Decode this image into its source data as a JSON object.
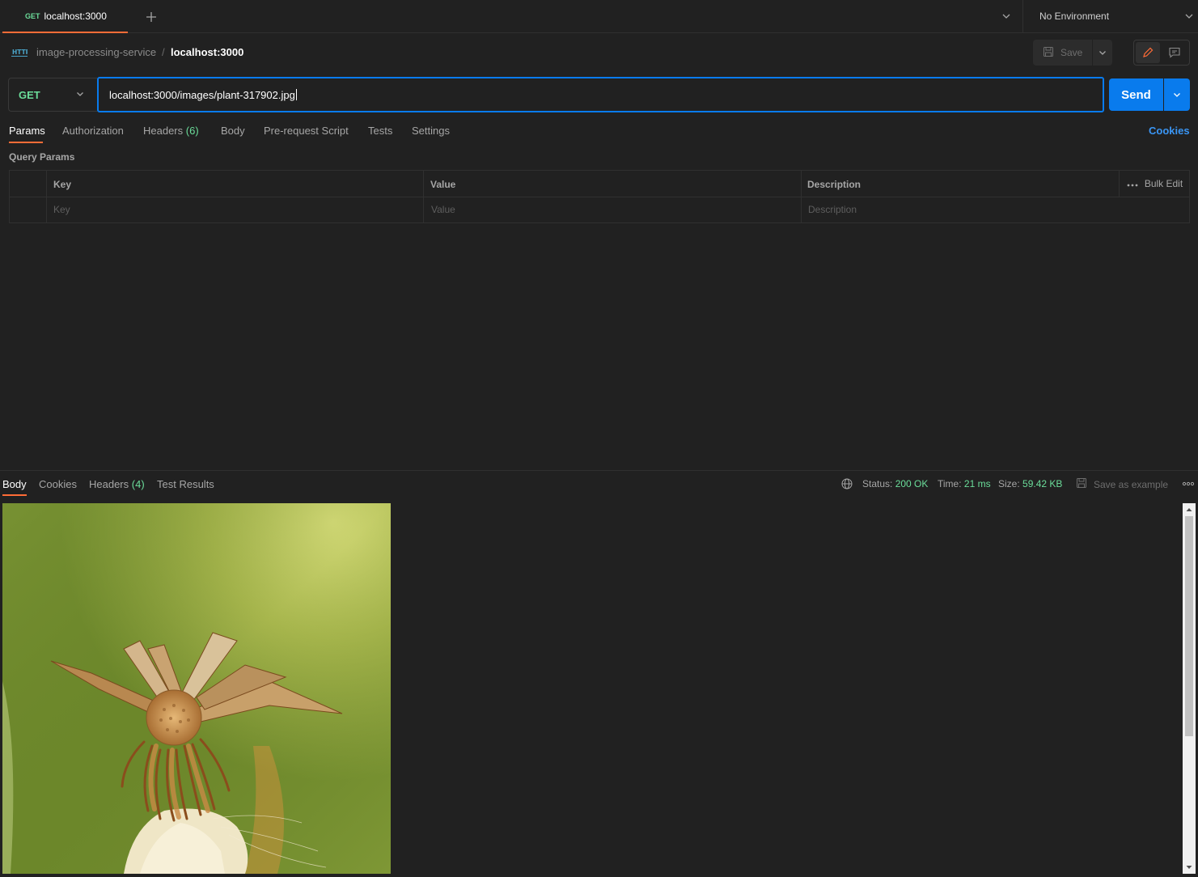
{
  "tab": {
    "method": "GET",
    "title": "localhost:3000"
  },
  "environment": {
    "label": "No Environment"
  },
  "breadcrumb": {
    "collection": "image-processing-service",
    "separator": "/",
    "request": "localhost:3000"
  },
  "toolbar": {
    "save_label": "Save"
  },
  "request": {
    "method": "GET",
    "url": "localhost:3000/images/plant-317902.jpg",
    "send_label": "Send"
  },
  "request_tabs": {
    "params": "Params",
    "authorization": "Authorization",
    "headers": "Headers",
    "headers_count": "(6)",
    "body": "Body",
    "pre_request": "Pre-request Script",
    "tests": "Tests",
    "settings": "Settings",
    "cookies": "Cookies"
  },
  "query_params": {
    "label": "Query Params",
    "columns": {
      "key": "Key",
      "value": "Value",
      "description": "Description"
    },
    "placeholders": {
      "key": "Key",
      "value": "Value",
      "description": "Description"
    },
    "bulk_edit": "Bulk Edit"
  },
  "response": {
    "tabs": {
      "body": "Body",
      "cookies": "Cookies",
      "headers": "Headers",
      "headers_count": "(4)",
      "test_results": "Test Results"
    },
    "status_label": "Status:",
    "status_value": "200 OK",
    "time_label": "Time:",
    "time_value": "21 ms",
    "size_label": "Size:",
    "size_value": "59.42 KB",
    "save_example": "Save as example"
  },
  "colors": {
    "accent_orange": "#ff6c37",
    "send_blue": "#097bed",
    "get_green": "#6bdd9a",
    "link_blue": "#3a96f5"
  }
}
